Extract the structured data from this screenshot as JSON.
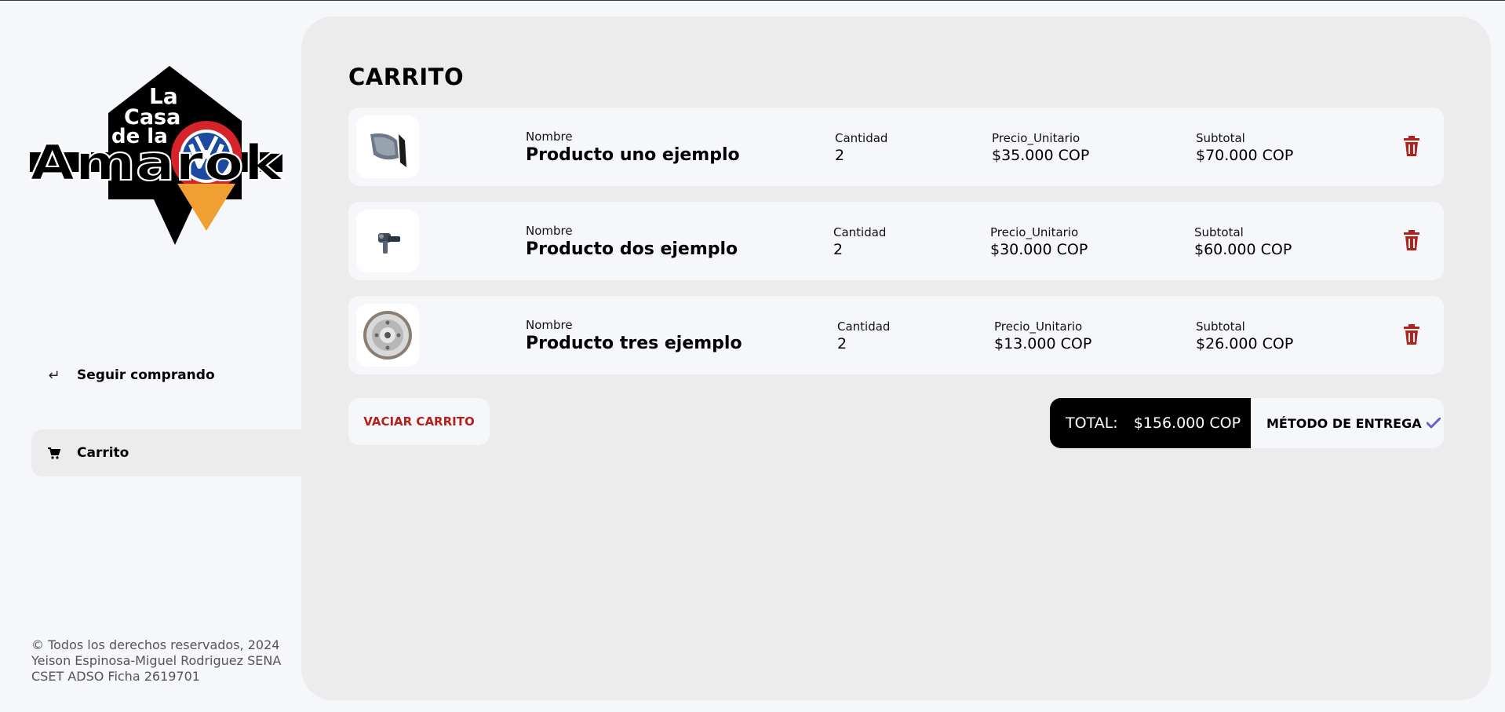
{
  "brand": {
    "logo_lines": [
      "La",
      "Casa",
      "de la",
      "Amarok"
    ]
  },
  "sidebar": {
    "continue_label": "Seguir comprando",
    "cart_label": "Carrito"
  },
  "footer": {
    "line1": "© Todos los derechos reservados, 2024",
    "line2": "Yeison Espinosa-Miguel Rodriguez SENA",
    "line3": "CSET ADSO Ficha 2619701"
  },
  "main": {
    "title": "CARRITO",
    "captions": {
      "name": "Nombre",
      "qty": "Cantidad",
      "price": "Precio_Unitario",
      "subtotal": "Subtotal"
    },
    "items": [
      {
        "name": "Producto uno ejemplo",
        "qty": "2",
        "price": "$35.000 COP",
        "subtotal": "$70.000 COP",
        "image": "side-mirror"
      },
      {
        "name": "Producto dos ejemplo",
        "qty": "2",
        "price": "$30.000 COP",
        "subtotal": "$60.000 COP",
        "image": "sensor-part"
      },
      {
        "name": "Producto tres ejemplo",
        "qty": "2",
        "price": "$13.000 COP",
        "subtotal": "$26.000 COP",
        "image": "flywheel"
      }
    ],
    "empty_cart_label": "VACIAR CARRITO",
    "total_label": "TOTAL:",
    "total_value": "$156.000 COP",
    "delivery_label": "MÉTODO DE ENTREGA"
  },
  "colors": {
    "accent_red": "#b3211b",
    "panel": "#ececec",
    "card": "#f6f7fb",
    "check": "#6d5ccf"
  }
}
